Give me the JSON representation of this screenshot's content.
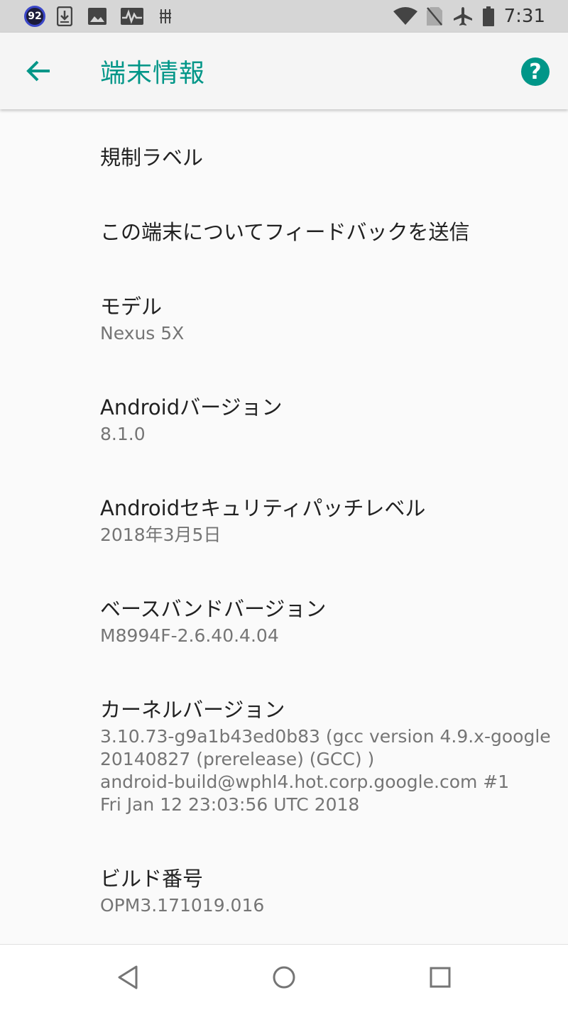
{
  "status_bar": {
    "notification_badge": "92",
    "time": "7:31"
  },
  "app_bar": {
    "title": "端末情報"
  },
  "items": [
    {
      "title": "規制ラベル"
    },
    {
      "title": "この端末についてフィードバックを送信"
    },
    {
      "title": "モデル",
      "summary": "Nexus 5X"
    },
    {
      "title": "Androidバージョン",
      "summary": "8.1.0"
    },
    {
      "title": "Androidセキュリティパッチレベル",
      "summary": "2018年3月5日"
    },
    {
      "title": "ベースバンドバージョン",
      "summary": "M8994F-2.6.40.4.04"
    },
    {
      "title": "カーネルバージョン",
      "summary_lines": [
        "3.10.73-g9a1b43ed0b83 (gcc version 4.9.x-google",
        "20140827 (prerelease) (GCC) )",
        "android-build@wphl4.hot.corp.google.com #1",
        "Fri Jan 12 23:03:56 UTC 2018"
      ]
    },
    {
      "title": "ビルド番号",
      "summary": "OPM3.171019.016"
    }
  ],
  "colors": {
    "accent": "#009688",
    "status_bar_bg": "#d6d6d6",
    "app_bar_bg": "#f5f5f5",
    "page_bg": "#fafafa"
  },
  "icons": [
    "notification-badge",
    "download-icon",
    "image-icon",
    "activity-icon",
    "usb-debug-icon",
    "wifi-icon",
    "no-sim-icon",
    "airplane-icon",
    "battery-icon",
    "back-arrow-icon",
    "help-icon",
    "nav-back-icon",
    "nav-home-icon",
    "nav-recents-icon"
  ]
}
